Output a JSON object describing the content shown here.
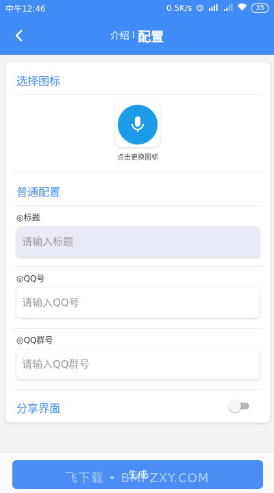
{
  "status_bar": {
    "time": "中午12:46",
    "speed": "0.5K/s",
    "battery": "35",
    "icons": [
      "alarm-icon",
      "hd-signal-icon",
      "signal-icon",
      "wifi-icon",
      "battery-icon"
    ]
  },
  "appbar": {
    "back_icon": "back-arrow-icon",
    "title_prefix": "介绍",
    "separator": "I",
    "title": "配置"
  },
  "icon_section": {
    "title": "选择图标",
    "icon": "microphone-icon",
    "caption": "点击更换图标"
  },
  "config_section": {
    "title": "普通配置",
    "fields": [
      {
        "label": "◎标题",
        "placeholder": "请输入标题",
        "value": ""
      },
      {
        "label": "◎QQ号",
        "placeholder": "请输入QQ号",
        "value": ""
      },
      {
        "label": "◎QQ群号",
        "placeholder": "请输入QQ群号",
        "value": ""
      }
    ]
  },
  "share": {
    "label": "分享界面",
    "enabled": false
  },
  "footer": {
    "generate_label": "生成",
    "watermark": "飞下载 • BMPZXY.COM"
  },
  "colors": {
    "primary": "#3f8cf7",
    "icon_blue": "#1c9be9",
    "active_field": "#e8ebf5"
  }
}
